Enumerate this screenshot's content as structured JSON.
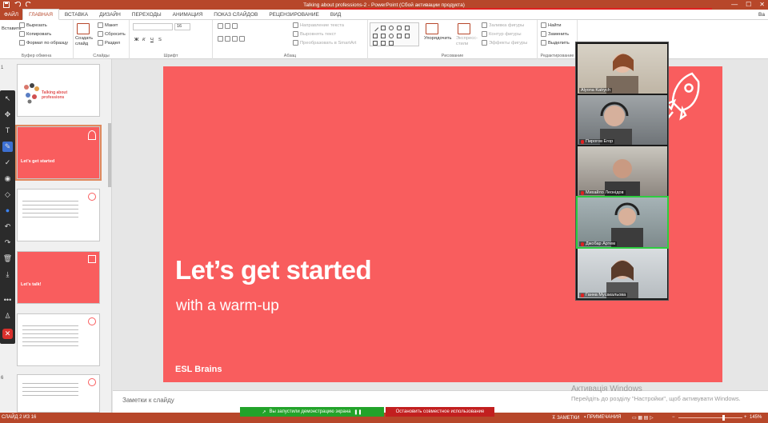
{
  "titlebar": {
    "title": "Talking about professions-2 - PowerPoint (Сбой активации продукта)",
    "min": "—",
    "max": "☐",
    "close": "✕"
  },
  "tabs": {
    "file": "ФАЙЛ",
    "items": [
      "ГЛАВНАЯ",
      "ВСТАВКА",
      "ДИЗАЙН",
      "ПЕРЕХОДЫ",
      "АНИМАЦИЯ",
      "ПОКАЗ СЛАЙДОВ",
      "РЕЦЕНЗИРОВАНИЕ",
      "ВИД"
    ],
    "user": "Ва"
  },
  "ribbon": {
    "clipboard": {
      "paste": "Вставить",
      "cut": "Вырезать",
      "copy": "Копировать",
      "format": "Формат по образцу",
      "label": "Буфер обмена"
    },
    "slides": {
      "new": "Создать слайд",
      "layout": "Макет",
      "reset": "Сбросить",
      "section": "Раздел",
      "label": "Слайды"
    },
    "font": {
      "size": "16",
      "label": "Шрифт"
    },
    "paragraph": {
      "direction": "Направление текста",
      "align": "Выровнять текст",
      "smartart": "Преобразовать в SmartArt",
      "label": "Абзац"
    },
    "drawing": {
      "arrange": "Упорядочить",
      "styles": "Экспресс-стили",
      "fill": "Заливка фигуры",
      "outline": "Контур фигуры",
      "effects": "Эффекты фигуры",
      "label": "Рисование"
    },
    "editing": {
      "find": "Найти",
      "replace": "Заменить",
      "select": "Выделить",
      "label": "Редактирование"
    }
  },
  "thumbnails": [
    {
      "num": "1",
      "title": "Talking about professions"
    },
    {
      "num": "2",
      "title": "Let’s get started"
    },
    {
      "num": "3",
      "title": ""
    },
    {
      "num": "4",
      "title": "Let’s talk!"
    },
    {
      "num": "5",
      "title": ""
    },
    {
      "num": "6",
      "title": ""
    }
  ],
  "slide": {
    "heading": "Let’s get started",
    "subheading": "with a warm-up",
    "brand": "ESL Brains",
    "bg_color": "#f95d5e"
  },
  "participants": [
    {
      "name": "Alyona Katrych",
      "muted": false
    },
    {
      "name": "Пирогов Егор",
      "muted": true
    },
    {
      "name": "Михайло Леонідов",
      "muted": true
    },
    {
      "name": "Джобар Артем",
      "muted": true
    },
    {
      "name": "Ганна Мусакальова",
      "muted": true
    }
  ],
  "notes": {
    "placeholder": "Заметки к слайду"
  },
  "watermark": {
    "line1": "Активація Windows",
    "line2": "Перейдіть до розділу \"Настройки\", щоб активувати Windows."
  },
  "share": {
    "status": "Вы запустили демонстрацию экрана",
    "stop": "Остановить совместное использование"
  },
  "status": {
    "slide_info": "СЛАЙД 2 ИЗ 16",
    "notes": "ЗАМЕТКИ",
    "comments": "ПРИМЕЧАНИЯ",
    "zoom": "145%"
  }
}
